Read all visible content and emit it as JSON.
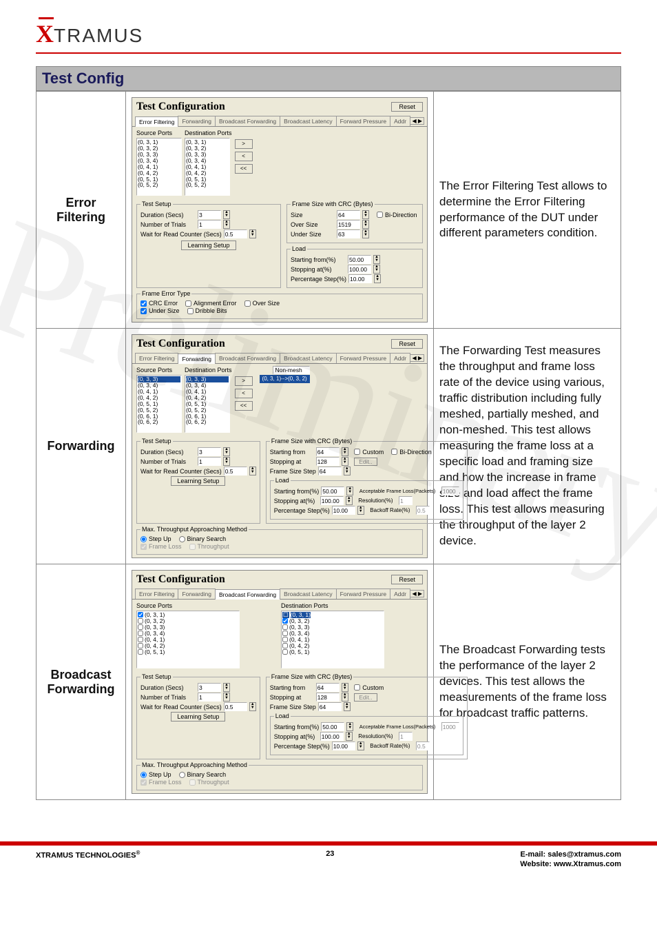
{
  "logo": {
    "x": "X",
    "rest": "TRAMUS"
  },
  "section_title": "Test Config",
  "common": {
    "config_title": "Test Configuration",
    "reset": "Reset",
    "tabs": [
      "Error Filtering",
      "Forwarding",
      "Broadcast Forwarding",
      "Broadcast Latency",
      "Forward Pressure",
      "Addr"
    ],
    "source_ports_label": "Source Ports",
    "dest_ports_label": "Destination Ports",
    "port_items": [
      "(0, 3, 1)",
      "(0, 3, 2)",
      "(0, 3, 3)",
      "(0, 3, 4)",
      "(0, 4, 1)",
      "(0, 4, 2)",
      "(0, 5, 1)",
      "(0, 5, 2)"
    ],
    "move_right": ">",
    "move_left": "<",
    "move_all_back": "<<",
    "test_setup": "Test Setup",
    "frame_size_crc": "Frame Size with CRC (Bytes)",
    "duration": "Duration (Secs)",
    "duration_v": "3",
    "trials": "Number of Trials",
    "trials_v": "1",
    "wait": "Wait for Read Counter (Secs)",
    "wait_v": "0.5",
    "learning": "Learning Setup",
    "load_legend": "Load",
    "start_from": "Starting from(%)",
    "start_from_v": "50.00",
    "stop_at": "Stopping at(%)",
    "stop_at_v": "100.00",
    "pct_step": "Percentage Step(%)",
    "pct_step_v": "10.00"
  },
  "row1": {
    "label": "Error\nFiltering",
    "bi": "Bi-Direction",
    "size": "Size",
    "size_v": "64",
    "over": "Over Size",
    "over_v": "1519",
    "under": "Under Size",
    "under_v": "63",
    "frame_err_legend": "Frame Error Type",
    "crc": "CRC Error",
    "align": "Alignment Error",
    "over_chk": "Over Size",
    "under_chk": "Under Size",
    "dribble": "Dribble Bits",
    "desc": "The Error Filtering Test allows to determine the Error Filtering performance of the DUT under different parameters condition."
  },
  "row2": {
    "label": "Forwarding",
    "mesh": "Non-mesh",
    "pair": "(0, 3, 1)-->(0, 3, 2)",
    "starting_from": "Starting from",
    "starting_from_v": "64",
    "custom": "Custom",
    "bi": "Bi-Direction",
    "stopping_at": "Stopping at",
    "stopping_at_v": "128",
    "edit": "Edit..",
    "frame_step": "Frame Size Step",
    "frame_step_v": "64",
    "max_method": "Max. Throughput Approaching Method",
    "stepup": "Step Up",
    "binary": "Binary Search",
    "frame_loss": "Frame Loss",
    "throughput": "Throughput",
    "acc_frame": "Acceptable Frame Loss(Packets)",
    "acc_v": "1000",
    "resolution": "Resolution(%)",
    "res_v": "1",
    "backoff": "Backoff Rate(%)",
    "backoff_v": "0.5",
    "desc": "The Forwarding Test measures the throughput and frame loss rate of the device using various, traffic distribution including fully meshed, partially meshed, and non-meshed. This test allows measuring the frame loss at a specific load and framing size and how the increase in frame size and load affect the frame loss. This test allows measuring the throughput of the layer 2 device."
  },
  "row3": {
    "label": "Broadcast\nForwarding",
    "desc": "The Broadcast Forwarding tests the performance of the layer 2 devices. This test allows the measurements of the frame loss for broadcast traffic patterns."
  },
  "footer": {
    "left": "XTRAMUS TECHNOLOGIES",
    "reg": "®",
    "page": "23",
    "email_label": "E-mail: ",
    "email": "sales@xtramus.com",
    "site_label": "Website:  ",
    "site": "www.Xtramus.com"
  }
}
